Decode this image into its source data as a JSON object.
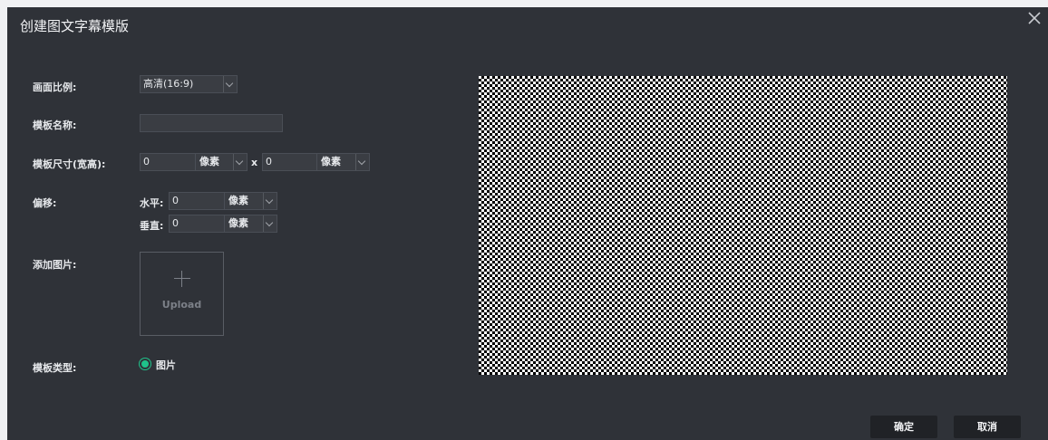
{
  "dialog": {
    "title": "创建图文字幕模版",
    "close_icon": "close-icon"
  },
  "form": {
    "aspect": {
      "label": "画面比例:",
      "value": "高清(16:9)"
    },
    "name": {
      "label": "模板名称:",
      "value": ""
    },
    "size": {
      "label": "模板尺寸(宽高):",
      "width": "0",
      "width_unit": "像素",
      "times": "x",
      "height": "0",
      "height_unit": "像素"
    },
    "offset": {
      "label": "偏移:",
      "horizontal_label": "水平:",
      "horizontal_value": "0",
      "horizontal_unit": "像素",
      "vertical_label": "垂直:",
      "vertical_value": "0",
      "vertical_unit": "像素"
    },
    "image": {
      "label": "添加图片:",
      "upload_text": "Upload"
    },
    "type": {
      "label": "模板类型:",
      "option": "图片",
      "selected": true
    }
  },
  "buttons": {
    "confirm": "确定",
    "cancel": "取消"
  },
  "colors": {
    "dialog_bg": "#2f3238",
    "accent": "#1fc28a",
    "button_bg": "#202226"
  }
}
